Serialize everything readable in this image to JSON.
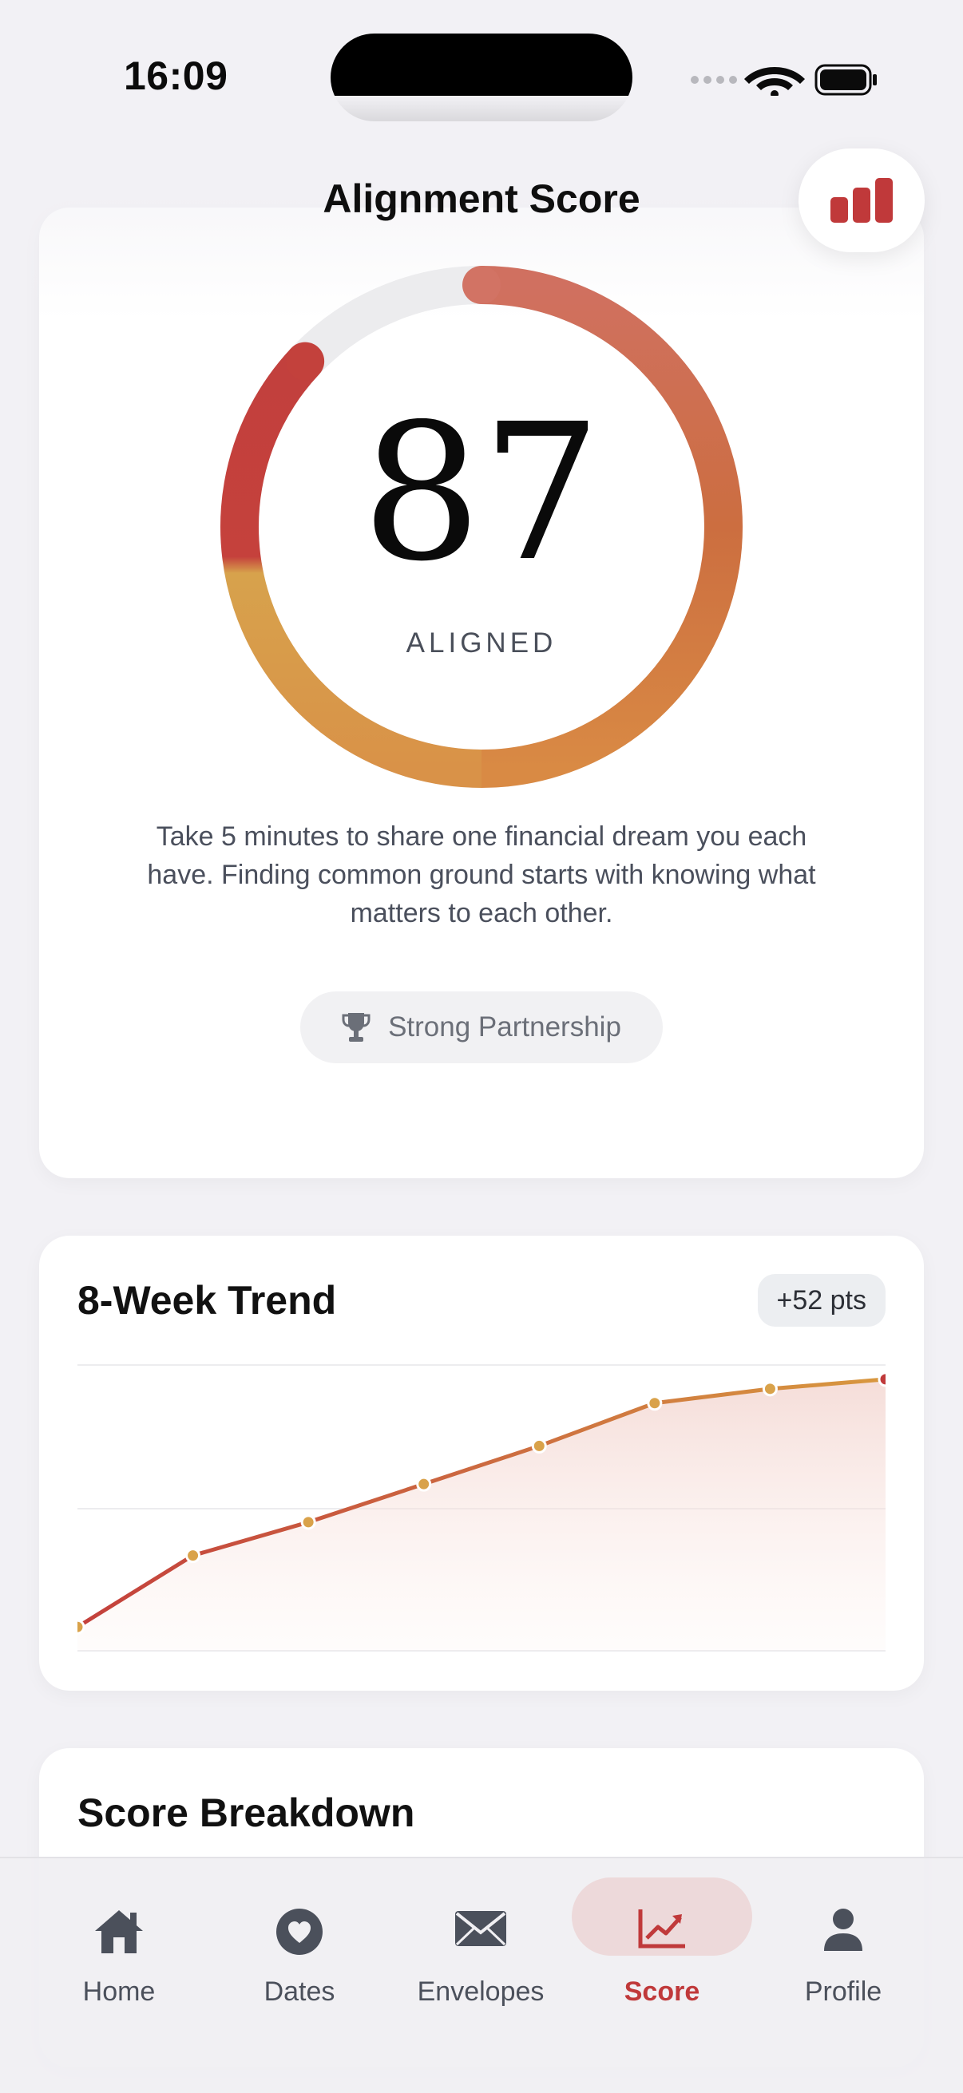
{
  "status_bar": {
    "time": "16:09"
  },
  "header": {
    "title": "Alignment Score",
    "action_icon": "bar-chart-icon"
  },
  "score": {
    "value": "87",
    "status": "ALIGNED",
    "progress_fraction": 0.87,
    "message": "Take 5 minutes to share one financial dream you each have. Finding common ground starts with knowing what matters to each other.",
    "badge": {
      "icon": "trophy-icon",
      "label": "Strong Partnership"
    }
  },
  "trend": {
    "title": "8-Week Trend",
    "delta": "+52 pts",
    "chart_data": {
      "type": "area",
      "x": [
        1,
        2,
        3,
        4,
        5,
        6,
        7,
        8
      ],
      "values": [
        35,
        50,
        57,
        65,
        73,
        82,
        85,
        87
      ],
      "ylim": [
        30,
        90
      ],
      "grid": true
    }
  },
  "breakdown": {
    "title": "Score Breakdown"
  },
  "tab_bar": {
    "tabs": [
      {
        "label": "Home",
        "icon": "home-icon",
        "active": false
      },
      {
        "label": "Dates",
        "icon": "heart-icon",
        "active": false
      },
      {
        "label": "Envelopes",
        "icon": "envelope-icon",
        "active": false
      },
      {
        "label": "Score",
        "icon": "trend-chart-icon",
        "active": true
      },
      {
        "label": "Profile",
        "icon": "person-icon",
        "active": false
      }
    ]
  },
  "colors": {
    "accent": "#c0393a",
    "ring_start": "#c4423c",
    "ring_mid": "#d9a24a",
    "ring_end": "#c96a40",
    "track": "#ececee"
  }
}
